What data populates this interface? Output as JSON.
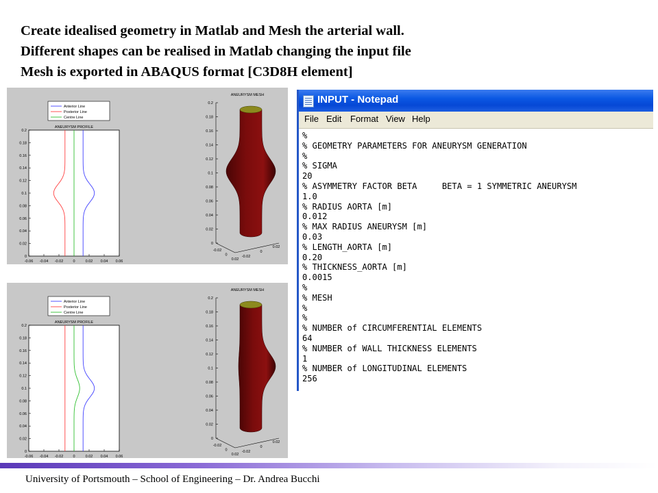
{
  "title_lines": [
    "Create idealised geometry in Matlab and Mesh the arterial wall.",
    "Different shapes can be realised in Matlab changing the input file",
    "Mesh is exported in ABAQUS format [C3D8H element]"
  ],
  "figures": [
    {
      "profile": {
        "title": "ANEURYSM PROFILE",
        "legend": [
          "Anterior Line",
          "Posterior Line",
          "Centre Line"
        ],
        "legend_colors": [
          "#4040ff",
          "#ff4040",
          "#30c030"
        ],
        "y_ticks": [
          "0.2",
          "0.18",
          "0.16",
          "0.14",
          "0.12",
          "0.1",
          "0.08",
          "0.06",
          "0.04",
          "0.02",
          "0"
        ],
        "x_ticks": [
          "-0.06",
          "-0.04",
          "-0.02",
          "0",
          "0.02",
          "0.04",
          "0.06"
        ],
        "symmetric": true
      },
      "mesh": {
        "title": "ANEURYSM MESH",
        "z_ticks": [
          "0.2",
          "0.18",
          "0.16",
          "0.14",
          "0.12",
          "0.1",
          "0.08",
          "0.06",
          "0.04",
          "0.02",
          "0"
        ],
        "x_ticks": [
          "-0.02",
          "0",
          "0.02"
        ],
        "y_ticks": [
          "-0.02",
          "0",
          "0.02"
        ],
        "color": "#7a0c0c",
        "cap_color": "#8c8a1e",
        "symmetric": true
      }
    },
    {
      "profile": {
        "title": "ANEURYSM PROFILE",
        "legend": [
          "Anterior Line",
          "Posterior Line",
          "Centre Line"
        ],
        "legend_colors": [
          "#4040ff",
          "#ff4040",
          "#30c030"
        ],
        "y_ticks": [
          "0.2",
          "0.18",
          "0.16",
          "0.14",
          "0.12",
          "0.1",
          "0.08",
          "0.06",
          "0.04",
          "0.02",
          "0"
        ],
        "x_ticks": [
          "-0.06",
          "-0.04",
          "-0.02",
          "0",
          "0.02",
          "0.04",
          "0.06"
        ],
        "symmetric": false
      },
      "mesh": {
        "title": "ANEURYSM MESH",
        "z_ticks": [
          "0.2",
          "0.18",
          "0.16",
          "0.14",
          "0.12",
          "0.1",
          "0.08",
          "0.06",
          "0.04",
          "0.02",
          "0"
        ],
        "x_ticks": [
          "-0.02",
          "0",
          "0.02"
        ],
        "y_ticks": [
          "-0.02",
          "0",
          "0.02"
        ],
        "color": "#7a0c0c",
        "cap_color": "#8c8a1e",
        "symmetric": false
      }
    }
  ],
  "notepad": {
    "title": "INPUT - Notepad",
    "menu": [
      "File",
      "Edit",
      "Format",
      "View",
      "Help"
    ],
    "lines": [
      "%",
      "% GEOMETRY PARAMETERS FOR ANEURYSM GENERATION",
      "%",
      "% SIGMA",
      "20",
      "% ASYMMETRY FACTOR BETA     BETA = 1 SYMMETRIC ANEURYSM",
      "1.0",
      "% RADIUS AORTA [m]",
      "0.012",
      "% MAX RADIUS ANEURYSM [m]",
      "0.03",
      "% LENGTH_AORTA [m]",
      "0.20",
      "% THICKNESS_AORTA [m]",
      "0.0015",
      "%",
      "% MESH",
      "%",
      "%",
      "% NUMBER of CIRCUMFERENTIAL ELEMENTS",
      "64",
      "% NUMBER of WALL THICKNESS ELEMENTS",
      "1",
      "% NUMBER of LONGITUDINAL ELEMENTS",
      "256"
    ]
  },
  "footer": "University of Portsmouth – School of Engineering –  Dr. Andrea Bucchi"
}
